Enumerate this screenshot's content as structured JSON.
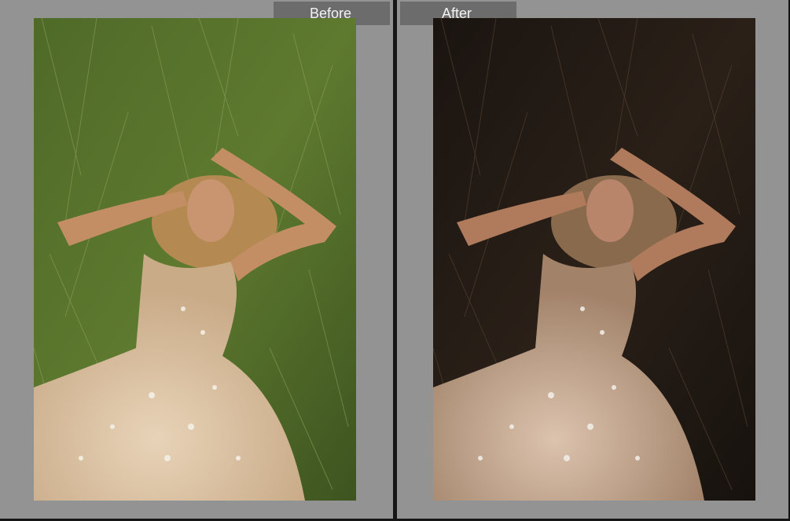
{
  "compare_view": {
    "before": {
      "label": "Before"
    },
    "after": {
      "label": "After"
    }
  },
  "colors": {
    "panel_bg": "#939393",
    "label_bg": "#6c6c6c",
    "divider": "#161616"
  }
}
